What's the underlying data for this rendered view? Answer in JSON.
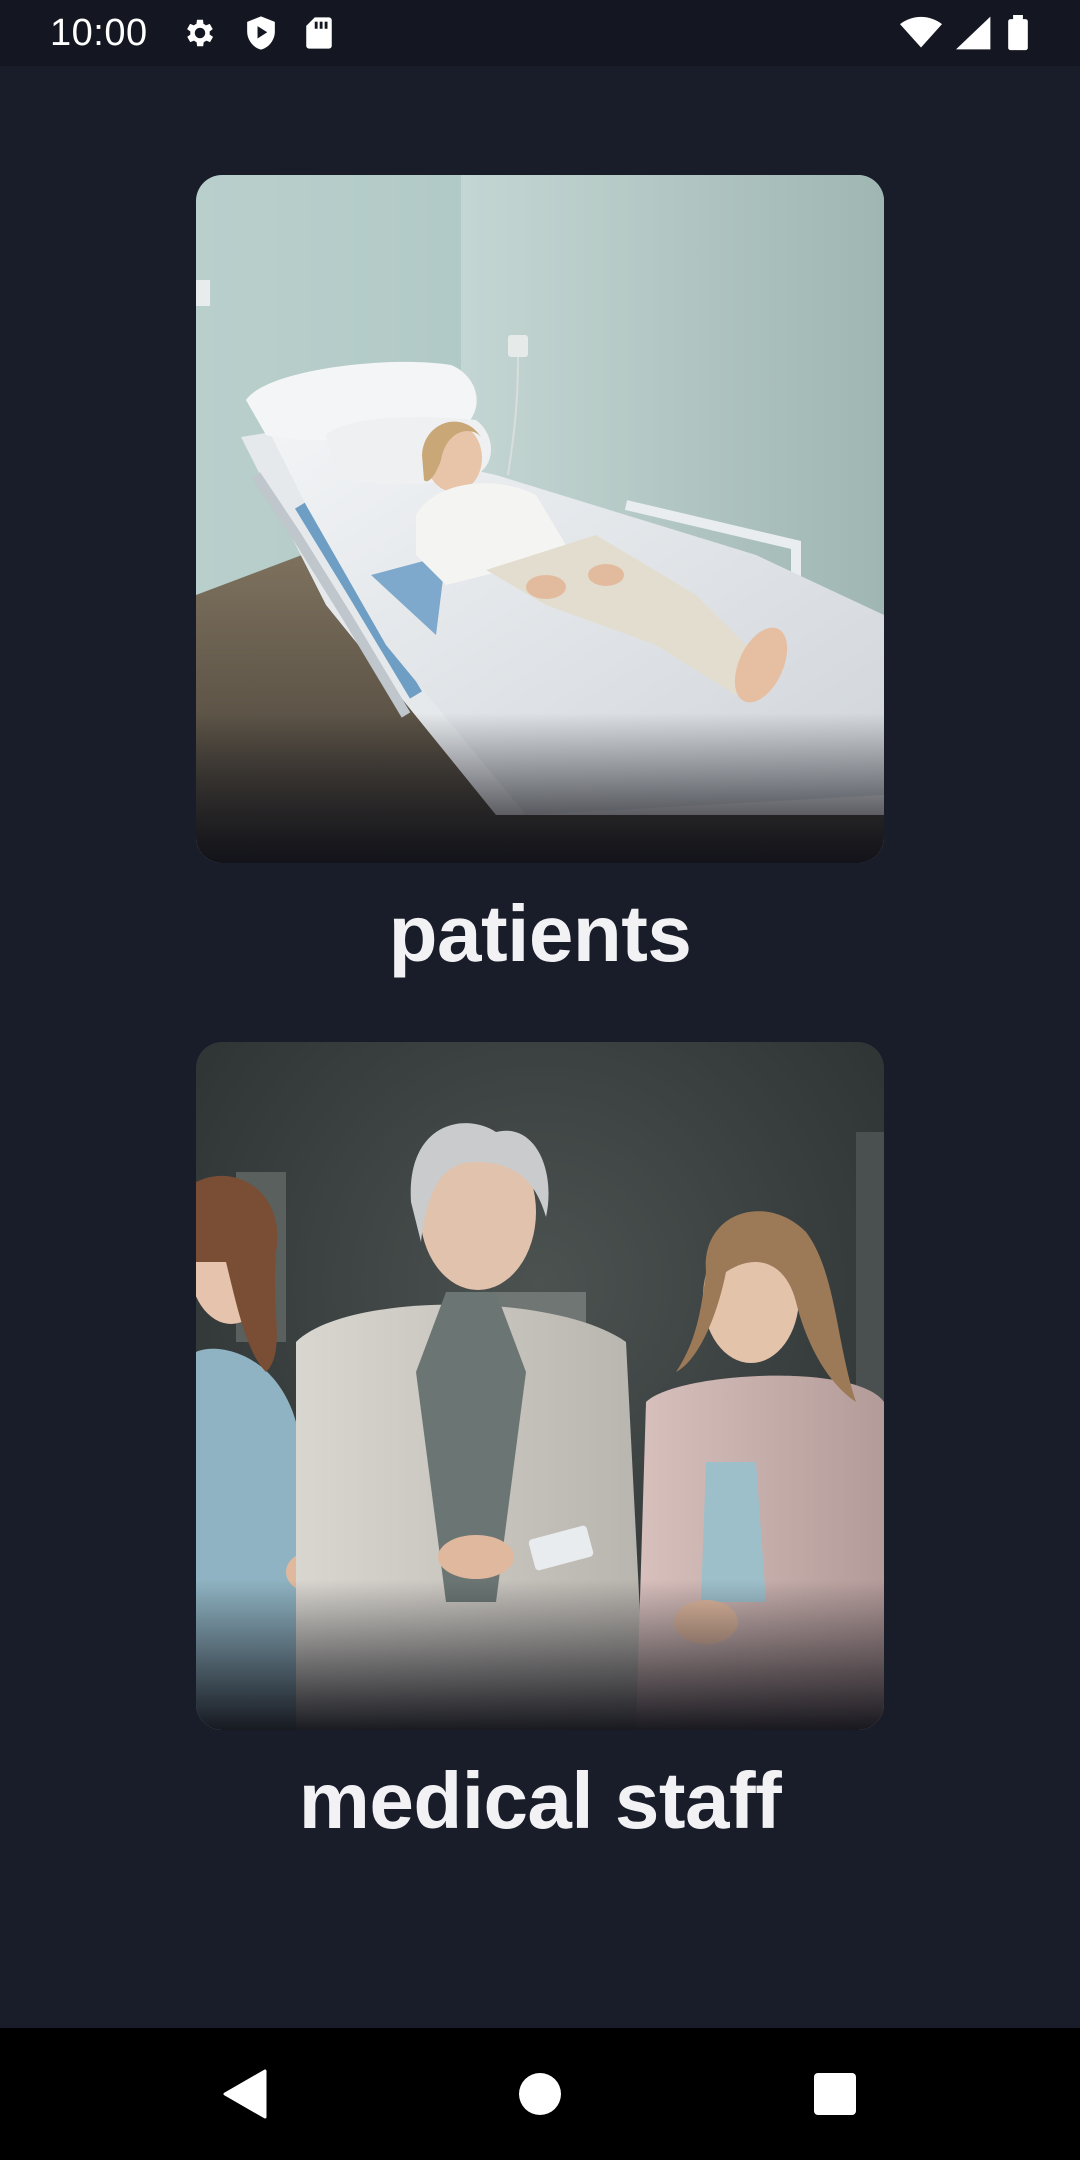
{
  "status_bar": {
    "time": "10:00",
    "left_icons": [
      "gear-icon",
      "shield-play-icon",
      "sd-card-icon"
    ],
    "right_icons": [
      "wifi-icon",
      "cell-signal-icon",
      "battery-icon"
    ]
  },
  "cards": [
    {
      "id": "patients",
      "label": "patients",
      "image": "patient-in-hospital-bed"
    },
    {
      "id": "medical_staff",
      "label": "medical staff",
      "image": "doctor-with-two-nurses"
    }
  ],
  "nav_bar": {
    "buttons": [
      "back-icon",
      "home-icon",
      "recents-icon"
    ]
  },
  "colors": {
    "background": "#191c29",
    "status_bar": "#141722",
    "label": "#f2f2f5",
    "nav_bar": "#000000"
  }
}
